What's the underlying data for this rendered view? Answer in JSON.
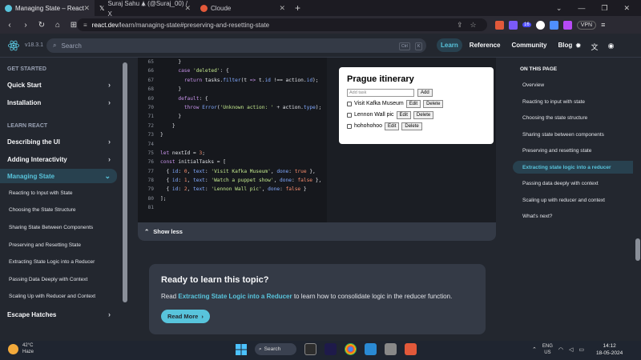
{
  "browser": {
    "tabs": [
      {
        "title": "Managing State – React",
        "active": true
      },
      {
        "title": "Suraj Sahu 🛦 (@Suraj_00) / X",
        "active": false
      },
      {
        "title": "Cloude",
        "active": false
      }
    ],
    "url": {
      "host": "react.dev",
      "path": "/learn/managing-state#preserving-and-resetting-state"
    },
    "vpn_label": "VPN",
    "ext_badge": "16"
  },
  "header": {
    "version": "v18.3.1",
    "search_placeholder": "Search",
    "search_kbd": [
      "Ctrl",
      "K"
    ],
    "nav": [
      {
        "label": "Learn",
        "active": true
      },
      {
        "label": "Reference",
        "active": false
      },
      {
        "label": "Community",
        "active": false
      },
      {
        "label": "Blog",
        "active": false
      }
    ]
  },
  "sidebar": {
    "section_get_started": "GET STARTED",
    "quick_start": "Quick Start",
    "installation": "Installation",
    "section_learn_react": "LEARN REACT",
    "describing_ui": "Describing the UI",
    "adding_interactivity": "Adding Interactivity",
    "managing_state": "Managing State",
    "sub_items": [
      "Reacting to Input with State",
      "Choosing the State Structure",
      "Sharing State Between Components",
      "Preserving and Resetting State",
      "Extracting State Logic into a Reducer",
      "Passing Data Deeply with Context",
      "Scaling Up with Reducer and Context"
    ],
    "escape_hatches": "Escape Hatches"
  },
  "code": {
    "line_numbers": [
      "65",
      "66",
      "67",
      "68",
      "69",
      "70",
      "71",
      "72",
      "73",
      "74",
      "75",
      "76",
      "77",
      "78",
      "79",
      "80",
      "81"
    ]
  },
  "preview": {
    "title": "Prague itinerary",
    "add_placeholder": "Add task",
    "add_label": "Add",
    "edit_label": "Edit",
    "delete_label": "Delete",
    "tasks": [
      "Visit Kafka Museum",
      "Lennon Wall pic",
      "hohohohoo"
    ]
  },
  "show_less": "Show less",
  "learn": {
    "heading": "Ready to learn this topic?",
    "text_before": "Read ",
    "link": "Extracting State Logic into a Reducer",
    "text_after": " to learn how to consolidate logic in the reducer function.",
    "button": "Read More"
  },
  "toc": {
    "heading": "ON THIS PAGE",
    "items": [
      {
        "label": "Overview",
        "active": false
      },
      {
        "label": "Reacting to input with state",
        "active": false
      },
      {
        "label": "Choosing the state structure",
        "active": false
      },
      {
        "label": "Sharing state between components",
        "active": false
      },
      {
        "label": "Preserving and resetting state",
        "active": false
      },
      {
        "label": "Extracting state logic into a reducer",
        "active": true
      },
      {
        "label": "Passing data deeply with context",
        "active": false
      },
      {
        "label": "Scaling up with reducer and context",
        "active": false
      },
      {
        "label": "What's next?",
        "active": false
      }
    ]
  },
  "taskbar": {
    "temp": "42°C",
    "condition": "Haze",
    "search": "Search",
    "lang": "ENG",
    "region": "US",
    "time": "14:12",
    "date": "18-05-2024"
  }
}
